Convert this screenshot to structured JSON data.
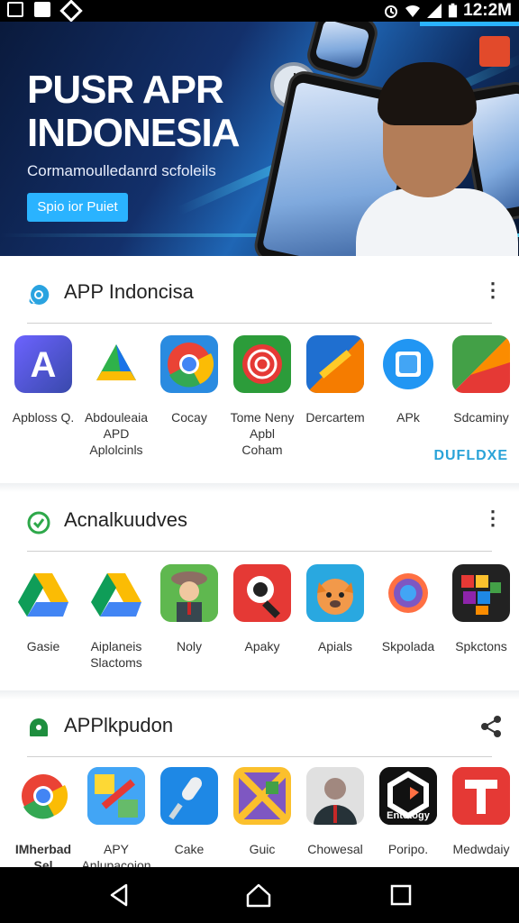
{
  "status_bar": {
    "time": "12:2M",
    "left_icons": [
      "notification-icon",
      "m-app-icon",
      "shield-icon"
    ],
    "right_icons": [
      "alarm-icon",
      "wifi-icon",
      "signal-icon",
      "battery-icon"
    ]
  },
  "banner": {
    "title_line1": "PUSR APR",
    "title_line2": "INDONESIA",
    "subtitle": "Cormamoulledanrd scfoleils",
    "button_label": "Spio ior Puiet"
  },
  "sections": [
    {
      "title": "APP Indoncisa",
      "icon": "chat-bubble-icon",
      "icon_color": "#2aa3e0",
      "apps": [
        {
          "label": "Apbloss Q.",
          "icon": "letter-a-icon",
          "color": "#4a5bd8"
        },
        {
          "label": "Abdouleaia\nAPD\nAplolcinls",
          "icon": "drive-triangle-icon",
          "color": "#2fb24a"
        },
        {
          "label": "Cocay",
          "icon": "chrome-icon",
          "color": "#2a8be0"
        },
        {
          "label": "Tome Neny\nApbl\nCoham",
          "icon": "spiral-icon",
          "color": "#2c9c3a"
        },
        {
          "label": "Dercartem",
          "icon": "pencil-icon",
          "color": "#1f6fd0"
        },
        {
          "label": "APk",
          "icon": "square-badge-icon",
          "color": "#2196f3"
        },
        {
          "label": "Sdcaminy",
          "icon": "fold-icon",
          "color": "#e94b3c"
        }
      ]
    },
    {
      "title": "Acnalkuudves",
      "icon": "check-circle-icon",
      "icon_color": "#2ea84a",
      "apps": [
        {
          "label": "Gasie",
          "icon": "drive-icon",
          "color": "#f4b400"
        },
        {
          "label": "Aiplaneis\nSlactoms",
          "icon": "drive-icon",
          "color": "#0f9d58"
        },
        {
          "label": "Noly",
          "icon": "character-icon",
          "color": "#3aa14a"
        },
        {
          "label": "Apaky",
          "icon": "magnifier-icon",
          "color": "#e53935"
        },
        {
          "label": "Apials",
          "icon": "fox-icon",
          "color": "#29a8e0"
        },
        {
          "label": "Skpolada",
          "icon": "camera-lens-icon",
          "color": "#1db584"
        },
        {
          "label": "Spkctons",
          "icon": "puzzle-icon",
          "color": "#222222"
        }
      ]
    },
    {
      "title": "APPlkpudon",
      "icon": "home-icon",
      "icon_color": "#1e8e3e",
      "share_icon": "share-icon",
      "apps": [
        {
          "label": "IMherbad\nSel",
          "icon": "chrome-icon",
          "color": "#db4437"
        },
        {
          "label": "APY\nAnlupacoion",
          "icon": "brush-icon",
          "color": "#3f51b5"
        },
        {
          "label": "Cake",
          "icon": "microphone-icon",
          "color": "#1e88e5"
        },
        {
          "label": "Guic",
          "icon": "grid-x-icon",
          "color": "#fbc02d"
        },
        {
          "label": "Chowesal",
          "icon": "portrait-icon",
          "color": "#9e9e9e"
        },
        {
          "label": "Poripo.",
          "icon": "entotogy-icon",
          "color": "#111111",
          "badge_text": "Entotogy"
        },
        {
          "label": "Medwdaiy",
          "icon": "letter-t-icon",
          "color": "#e53935"
        }
      ]
    }
  ],
  "watermark": "DUFLDXE",
  "nav": {
    "back": "back-icon",
    "home": "home-nav-icon",
    "recents": "recents-icon"
  }
}
